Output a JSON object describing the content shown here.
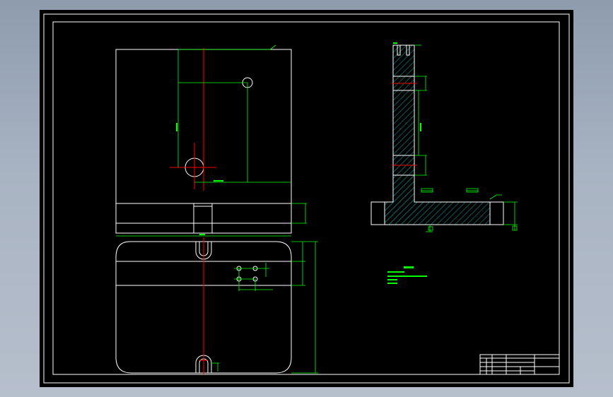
{
  "window": {
    "background_color": "#a0acbc"
  },
  "drawing": {
    "background_color": "#000000",
    "line_colors": {
      "outline": "#ffffff",
      "dimension": "#00ff00",
      "centerline": "#ff0000",
      "hatch": "#00ffff"
    }
  },
  "icons": [
    "hatch-pattern"
  ]
}
